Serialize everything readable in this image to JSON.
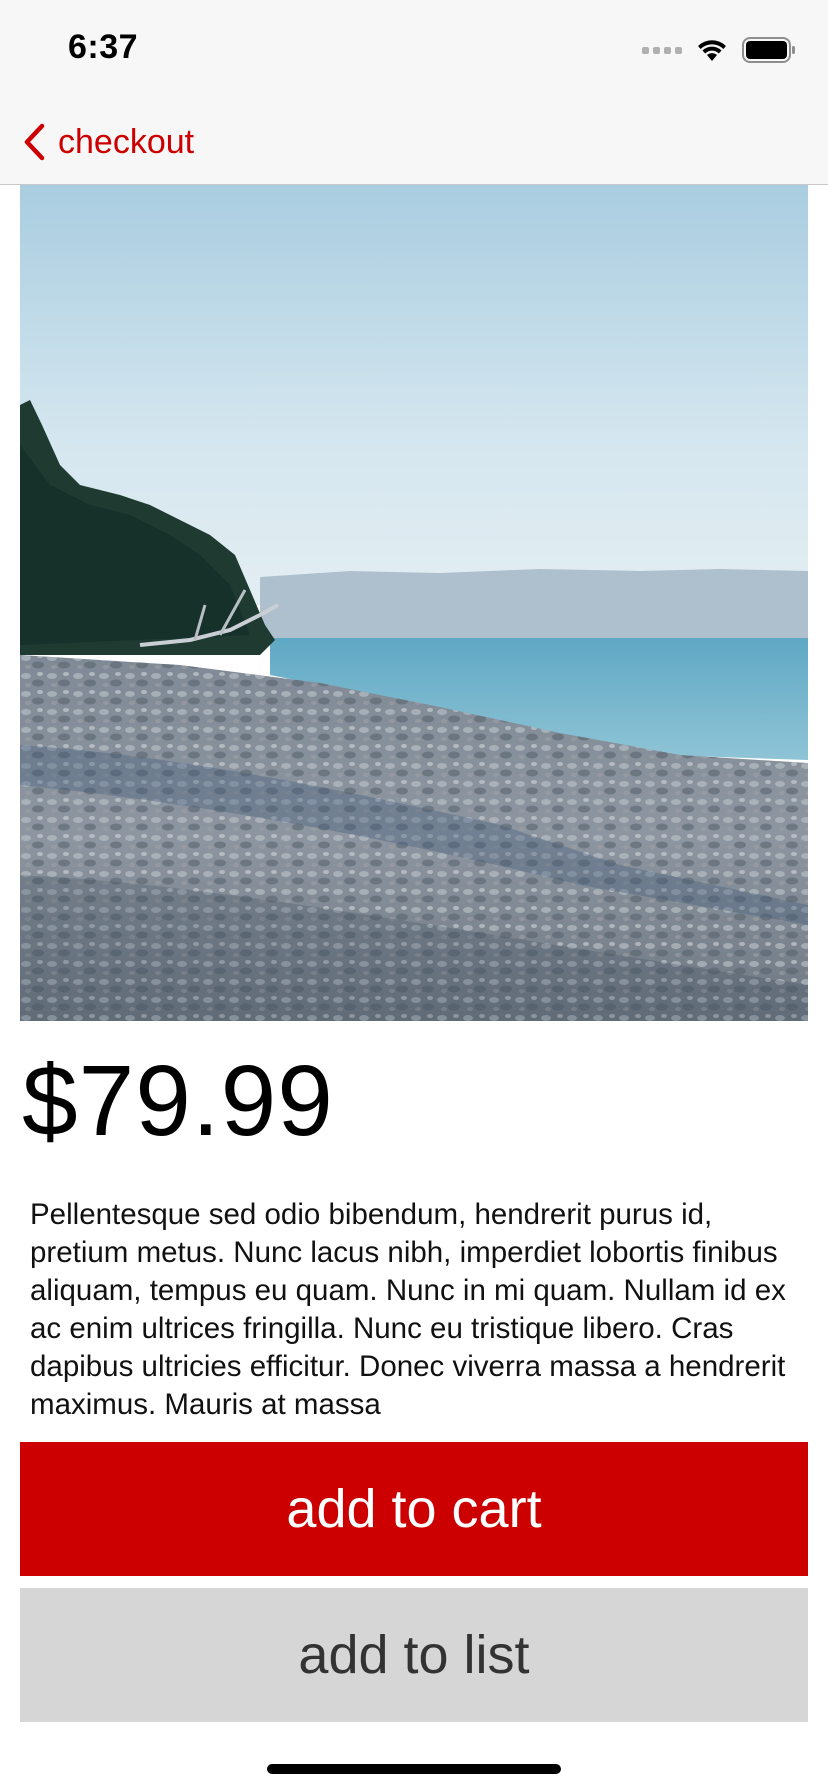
{
  "status_bar": {
    "time": "6:37"
  },
  "nav": {
    "back_label": "checkout"
  },
  "product": {
    "price": "$79.99",
    "description": "Pellentesque sed odio bibendum, hendrerit purus id, pretium metus. Nunc lacus nibh, imperdiet lobortis finibus aliquam, tempus eu quam. Nunc in mi quam. Nullam id ex ac enim ultrices fringilla. Nunc eu tristique libero. Cras dapibus ultricies efficitur. Donec viverra massa a hendrerit maximus. Mauris at massa"
  },
  "actions": {
    "add_to_cart_label": "add to cart",
    "add_to_list_label": "add to list"
  },
  "colors": {
    "accent": "#cc0000",
    "secondary_button": "#d6d6d6",
    "bar_background": "#f7f7f7"
  },
  "icons": {
    "back": "chevron-left-icon",
    "signal": "cellular-signal-icon",
    "wifi": "wifi-icon",
    "battery": "battery-icon"
  }
}
